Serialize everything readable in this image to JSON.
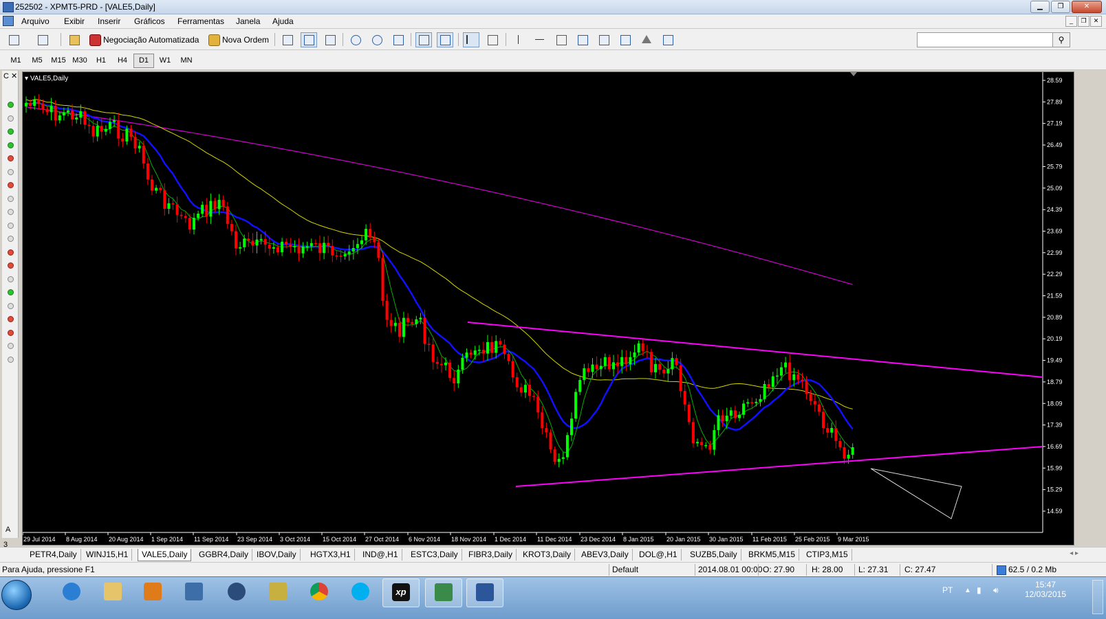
{
  "window": {
    "title": "252502 - XPMT5-PRD - [VALE5,Daily]"
  },
  "menu": [
    "Arquivo",
    "Exibir",
    "Inserir",
    "Gráficos",
    "Ferramentas",
    "Janela",
    "Ajuda"
  ],
  "toolbar": {
    "auto_trading": "Negociação Automatizada",
    "new_order": "Nova Ordem",
    "search_placeholder": ""
  },
  "timeframes": [
    {
      "label": "M1",
      "active": false
    },
    {
      "label": "M5",
      "active": false
    },
    {
      "label": "M15",
      "active": false
    },
    {
      "label": "M30",
      "active": false
    },
    {
      "label": "H1",
      "active": false
    },
    {
      "label": "H4",
      "active": false
    },
    {
      "label": "D1",
      "active": true
    },
    {
      "label": "W1",
      "active": false
    },
    {
      "label": "MN",
      "active": false
    }
  ],
  "left_panel": {
    "close_label": "C ✕",
    "bottom_label": "A",
    "bottom_number": "3"
  },
  "chart": {
    "symbol_label": "VALE5,Daily",
    "price_ticks": [
      "28.59",
      "27.89",
      "27.19",
      "26.49",
      "25.79",
      "25.09",
      "24.39",
      "23.69",
      "22.99",
      "22.29",
      "21.59",
      "20.89",
      "20.19",
      "19.49",
      "18.79",
      "18.09",
      "17.39",
      "16.69",
      "15.99",
      "15.29",
      "14.59"
    ],
    "date_ticks": [
      "29 Jul 2014",
      "8 Aug 2014",
      "20 Aug 2014",
      "1 Sep 2014",
      "11 Sep 2014",
      "23 Sep 2014",
      "3 Oct 2014",
      "15 Oct 2014",
      "27 Oct 2014",
      "6 Nov 2014",
      "18 Nov 2014",
      "1 Dec 2014",
      "11 Dec 2014",
      "23 Dec 2014",
      "8 Jan 2015",
      "20 Jan 2015",
      "30 Jan 2015",
      "11 Feb 2015",
      "25 Feb 2015",
      "9 Mar 2015"
    ],
    "colors": {
      "bull": "#00ff00",
      "bear": "#ff0000",
      "ma_fast": "#00b000",
      "ma_mid": "#1010ff",
      "ma_slow": "#d4d400",
      "ma_long": "#d000d0",
      "trendline": "#ff00ff"
    }
  },
  "symbol_tabs": [
    {
      "label": "PETR4,Daily",
      "active": false
    },
    {
      "label": "WINJ15,H1",
      "active": false
    },
    {
      "label": "VALE5,Daily",
      "active": true
    },
    {
      "label": "GGBR4,Daily",
      "active": false
    },
    {
      "label": "IBOV,Daily",
      "active": false
    },
    {
      "label": "HGTX3,H1",
      "active": false
    },
    {
      "label": "IND@,H1",
      "active": false
    },
    {
      "label": "ESTC3,Daily",
      "active": false
    },
    {
      "label": "FIBR3,Daily",
      "active": false
    },
    {
      "label": "KROT3,Daily",
      "active": false
    },
    {
      "label": "ABEV3,Daily",
      "active": false
    },
    {
      "label": "DOL@,H1",
      "active": false
    },
    {
      "label": "SUZB5,Daily",
      "active": false
    },
    {
      "label": "BRKM5,M15",
      "active": false
    },
    {
      "label": "CTIP3,M15",
      "active": false
    }
  ],
  "status": {
    "help": "Para Ajuda, pressione F1",
    "profile": "Default",
    "datetime": "2014.08.01 00:00",
    "open": "O: 27.90",
    "high": "H: 28.00",
    "low": "L: 27.31",
    "close": "C: 27.47",
    "traffic": "62.5 / 0.2 Mb"
  },
  "taskbar": {
    "lang": "PT",
    "time": "15:47",
    "date": "12/03/2015",
    "xp_label": "xp"
  }
}
